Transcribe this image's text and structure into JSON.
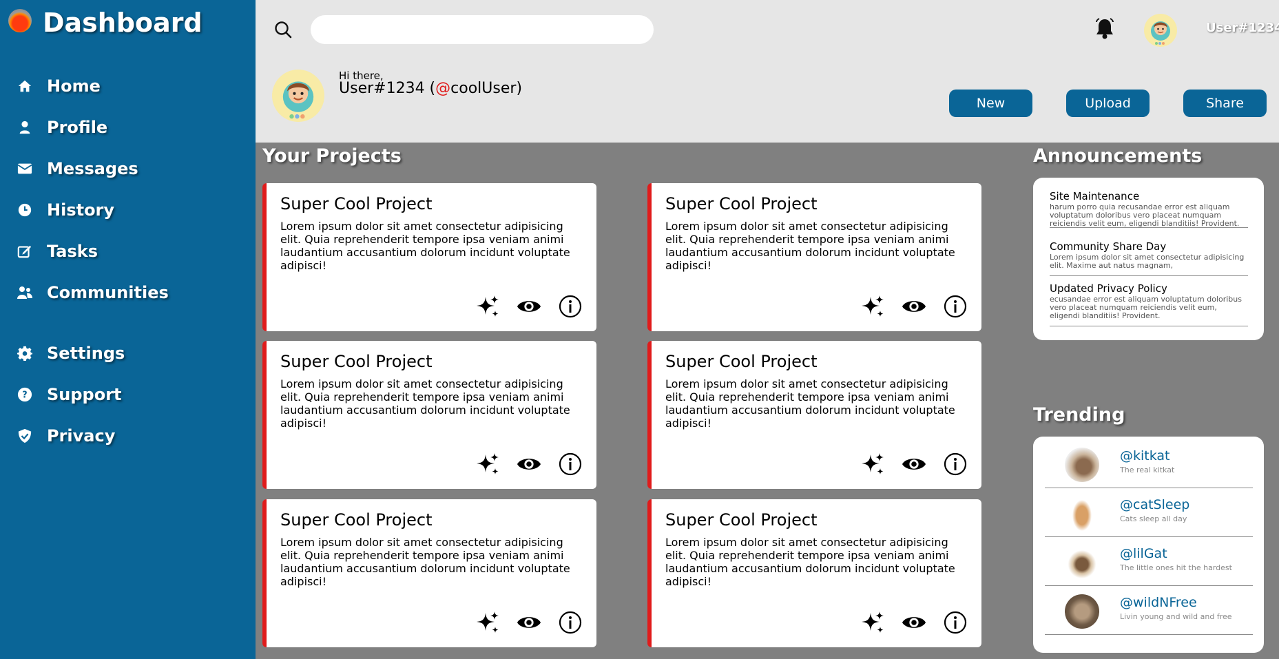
{
  "sidebar": {
    "title": "Dashboard",
    "items": [
      {
        "label": "Home",
        "icon": "home-icon"
      },
      {
        "label": "Profile",
        "icon": "user-icon"
      },
      {
        "label": "Messages",
        "icon": "envelope-icon"
      },
      {
        "label": "History",
        "icon": "clock-icon"
      },
      {
        "label": "Tasks",
        "icon": "edit-icon"
      },
      {
        "label": "Communities",
        "icon": "users-icon"
      },
      {
        "label": "Settings",
        "icon": "gear-icon"
      },
      {
        "label": "Support",
        "icon": "question-icon"
      },
      {
        "label": "Privacy",
        "icon": "shield-icon"
      }
    ]
  },
  "header": {
    "search_placeholder": "",
    "username": "User#1234",
    "greeting": "Hi there,",
    "display_name": "User#1234 (",
    "handle_at": "@",
    "handle": "coolUser",
    "handle_close": ")",
    "buttons": {
      "new": "New",
      "upload": "Upload",
      "share": "Share"
    }
  },
  "projects": {
    "title": "Your Projects",
    "cards": [
      {
        "title": "Super Cool Project",
        "desc": "Lorem ipsum dolor sit amet consectetur adipisicing elit. Quia reprehenderit tempore ipsa veniam animi laudantium accusantium dolorum incidunt voluptate adipisci!"
      },
      {
        "title": "Super Cool Project",
        "desc": "Lorem ipsum dolor sit amet consectetur adipisicing elit. Quia reprehenderit tempore ipsa veniam animi laudantium accusantium dolorum incidunt voluptate adipisci!"
      },
      {
        "title": "Super Cool Project",
        "desc": "Lorem ipsum dolor sit amet consectetur adipisicing elit. Quia reprehenderit tempore ipsa veniam animi laudantium accusantium dolorum incidunt voluptate adipisci!"
      },
      {
        "title": "Super Cool Project",
        "desc": "Lorem ipsum dolor sit amet consectetur adipisicing elit. Quia reprehenderit tempore ipsa veniam animi laudantium accusantium dolorum incidunt voluptate adipisci!"
      },
      {
        "title": "Super Cool Project",
        "desc": "Lorem ipsum dolor sit amet consectetur adipisicing elit. Quia reprehenderit tempore ipsa veniam animi laudantium accusantium dolorum incidunt voluptate adipisci!"
      },
      {
        "title": "Super Cool Project",
        "desc": "Lorem ipsum dolor sit amet consectetur adipisicing elit. Quia reprehenderit tempore ipsa veniam animi laudantium accusantium dolorum incidunt voluptate adipisci!"
      }
    ]
  },
  "announcements": {
    "title": "Announcements",
    "items": [
      {
        "title": "Site Maintenance",
        "text": "harum porro quia recusandae error est aliquam voluptatum doloribus vero placeat numquam reiciendis velit eum, eligendi blanditiis! Provident."
      },
      {
        "title": "Community Share Day",
        "text": "Lorem ipsum dolor sit amet consectetur adipisicing elit. Maxime aut natus magnam,"
      },
      {
        "title": "Updated Privacy Policy",
        "text": "ecusandae error est aliquam voluptatum doloribus vero placeat numquam reiciendis velit eum, eligendi blanditiis! Provident."
      }
    ]
  },
  "trending": {
    "title": "Trending",
    "items": [
      {
        "handle": "@kitkat",
        "bio": "The real kitkat"
      },
      {
        "handle": "@catSleep",
        "bio": "Cats sleep all day"
      },
      {
        "handle": "@lilGat",
        "bio": "The little ones hit the hardest"
      },
      {
        "handle": "@wildNFree",
        "bio": "Livin young and wild and free"
      }
    ]
  },
  "colors": {
    "sidebar": "#0a6597",
    "accent_red": "#e01b1b",
    "header_bg": "#e6e6e6",
    "main_bg": "#808080"
  }
}
